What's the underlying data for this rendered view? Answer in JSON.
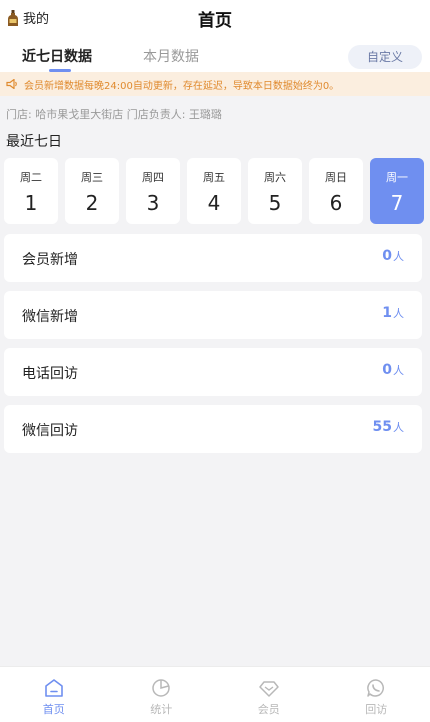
{
  "header": {
    "me_label": "我的",
    "title": "首页"
  },
  "tabs": {
    "items": [
      {
        "label": "近七日数据",
        "active": true
      },
      {
        "label": "本月数据",
        "active": false
      }
    ],
    "custom_button": "自定义"
  },
  "notice": {
    "text": "会员新增数据每晚24:00自动更新，存在延迟，导致本日数据始终为0。"
  },
  "store": {
    "text": "门店: 哈市果戈里大街店  门店负责人: 王璐璐"
  },
  "recent": {
    "title": "最近七日",
    "days": [
      {
        "weekday": "周二",
        "date": "1"
      },
      {
        "weekday": "周三",
        "date": "2"
      },
      {
        "weekday": "周四",
        "date": "3"
      },
      {
        "weekday": "周五",
        "date": "4"
      },
      {
        "weekday": "周六",
        "date": "5"
      },
      {
        "weekday": "周日",
        "date": "6"
      },
      {
        "weekday": "周一",
        "date": "7"
      }
    ],
    "selected_index": 6
  },
  "stats": [
    {
      "label": "会员新增",
      "value": "0",
      "unit": "人"
    },
    {
      "label": "微信新增",
      "value": "1",
      "unit": "人"
    },
    {
      "label": "电话回访",
      "value": "0",
      "unit": "人"
    },
    {
      "label": "微信回访",
      "value": "55",
      "unit": "人"
    }
  ],
  "bottom_nav": [
    {
      "label": "首页",
      "icon": "home-icon",
      "active": true
    },
    {
      "label": "统计",
      "icon": "pie-chart-icon",
      "active": false
    },
    {
      "label": "会员",
      "icon": "diamond-icon",
      "active": false
    },
    {
      "label": "回访",
      "icon": "phone-chat-icon",
      "active": false
    }
  ],
  "colors": {
    "accent": "#6f8ff0",
    "notice_bg": "#fbeedf",
    "notice_text": "#e08a2e",
    "page_bg": "#f3f3f5"
  }
}
